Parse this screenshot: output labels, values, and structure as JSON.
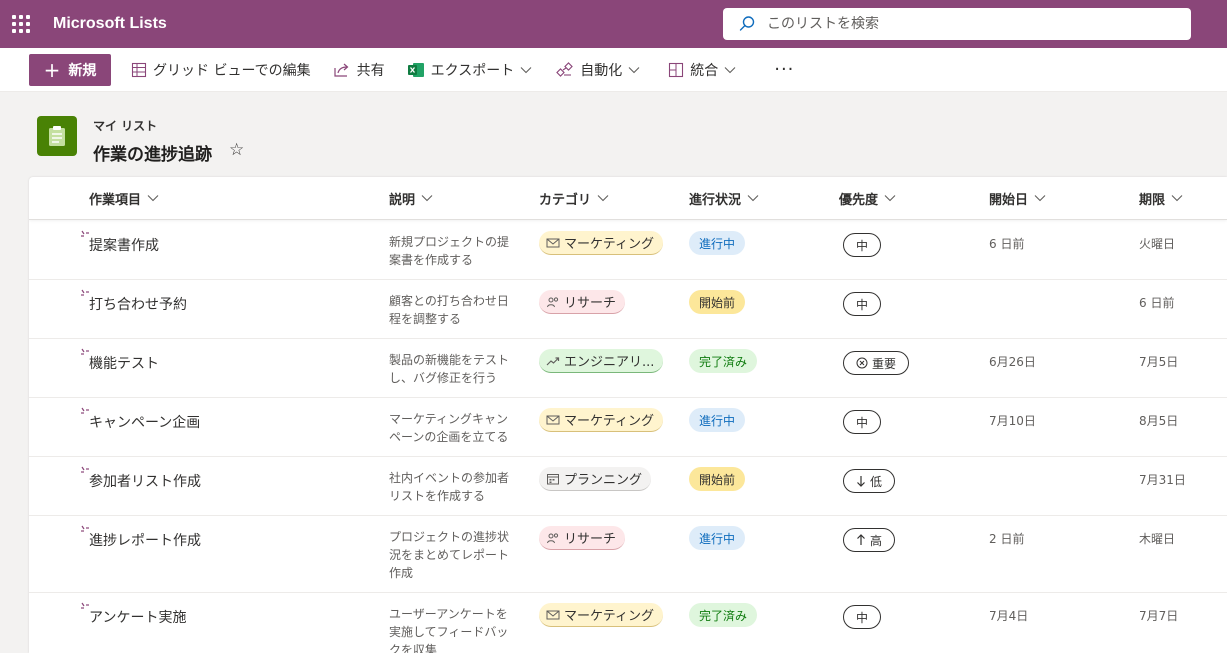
{
  "app": {
    "name": "Microsoft Lists"
  },
  "search": {
    "placeholder": "このリストを検索"
  },
  "commands": {
    "new_label": "新規",
    "grid_edit_label": "グリッド ビューでの編集",
    "share_label": "共有",
    "export_label": "エクスポート",
    "automate_label": "自動化",
    "integrate_label": "統合",
    "more_label": "···"
  },
  "list": {
    "breadcrumb": "マイ リスト",
    "title": "作業の進捗追跡",
    "star": "☆"
  },
  "columns": {
    "title": "作業項目",
    "desc": "説明",
    "category": "カテゴリ",
    "status": "進行状況",
    "priority": "優先度",
    "start": "開始日",
    "due": "期限"
  },
  "colors": {
    "brand": "#8a4679",
    "list_icon": "#498205",
    "cat_marketing": "#fff4ce",
    "cat_research": "#fde7e9",
    "cat_engineering": "#dff6dd",
    "cat_planning": "#f3f2f1",
    "status_in_progress_bg": "#deecf9",
    "status_in_progress_fg": "#0f6cbd",
    "status_not_started_bg": "#fce100",
    "status_done_bg": "#dff6dd",
    "status_done_fg": "#107c10"
  },
  "rows": [
    {
      "title": "提案書作成",
      "desc": "新規プロジェクトの提案書を作成する",
      "category": "マーケティング",
      "cat_icon": "mail-icon",
      "status": "進行中",
      "priority": "中",
      "pri_icon": "",
      "start": "6 日前",
      "due": "火曜日"
    },
    {
      "title": "打ち合わせ予約",
      "desc": "顧客との打ち合わせ日程を調整する",
      "category": "リサーチ",
      "cat_icon": "people-icon",
      "status": "開始前",
      "priority": "中",
      "pri_icon": "",
      "start": "",
      "due": "6 日前"
    },
    {
      "title": "機能テスト",
      "desc": "製品の新機能をテストし、バグ修正を行う",
      "category": "エンジニアリ...",
      "cat_icon": "trend-icon",
      "status": "完了済み",
      "priority": "重要",
      "pri_icon": "important-icon",
      "start": "6月26日",
      "due": "7月5日"
    },
    {
      "title": "キャンペーン企画",
      "desc": "マーケティングキャンペーンの企画を立てる",
      "category": "マーケティング",
      "cat_icon": "mail-icon",
      "status": "進行中",
      "priority": "中",
      "pri_icon": "",
      "start": "7月10日",
      "due": "8月5日"
    },
    {
      "title": "参加者リスト作成",
      "desc": "社内イベントの参加者リストを作成する",
      "category": "プランニング",
      "cat_icon": "calendar-icon",
      "status": "開始前",
      "priority": "低",
      "pri_icon": "arrow-down-icon",
      "start": "",
      "due": "7月31日"
    },
    {
      "title": "進捗レポート作成",
      "desc": "プロジェクトの進捗状況をまとめてレポート作成",
      "category": "リサーチ",
      "cat_icon": "people-icon",
      "status": "進行中",
      "priority": "高",
      "pri_icon": "arrow-up-icon",
      "start": "2 日前",
      "due": "木曜日"
    },
    {
      "title": "アンケート実施",
      "desc": "ユーザーアンケートを実施してフィードバックを収集",
      "category": "マーケティング",
      "cat_icon": "mail-icon",
      "status": "完了済み",
      "priority": "中",
      "pri_icon": "",
      "start": "7月4日",
      "due": "7月7日"
    }
  ]
}
